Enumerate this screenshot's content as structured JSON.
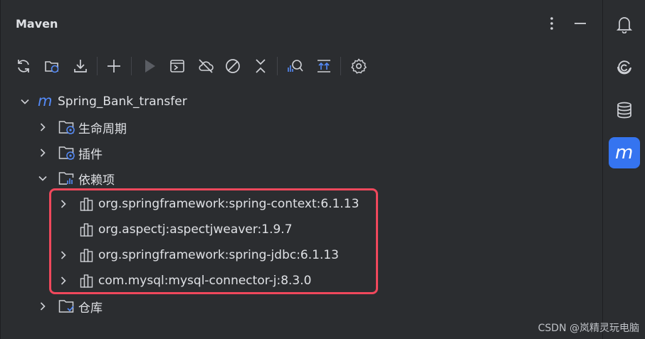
{
  "header": {
    "title": "Maven"
  },
  "toolbar": {
    "icons": [
      "reload-icon",
      "reload-projects-icon",
      "download-icon",
      "add-icon",
      "run-icon",
      "execute-goal-icon",
      "offline-icon",
      "skip-tests-icon",
      "collapse-icon",
      "analyze-dependencies-icon",
      "show-diagram-icon",
      "settings-icon"
    ]
  },
  "tree": {
    "project": "Spring_Bank_transfer",
    "lifecycle": "生命周期",
    "plugins": "插件",
    "dependencies": "依赖项",
    "deps": [
      "org.springframework:spring-context:6.1.13",
      "org.aspectj:aspectjweaver:1.9.7",
      "org.springframework:spring-jdbc:6.1.13",
      "com.mysql:mysql-connector-j:8.3.0"
    ],
    "repositories": "仓库"
  },
  "sidebar": {
    "maven_letter": "m"
  },
  "watermark": "CSDN @岚精灵玩电脑",
  "colors": {
    "accent": "#3574f0",
    "highlight": "#f0485c",
    "background": "#2b2d30"
  }
}
